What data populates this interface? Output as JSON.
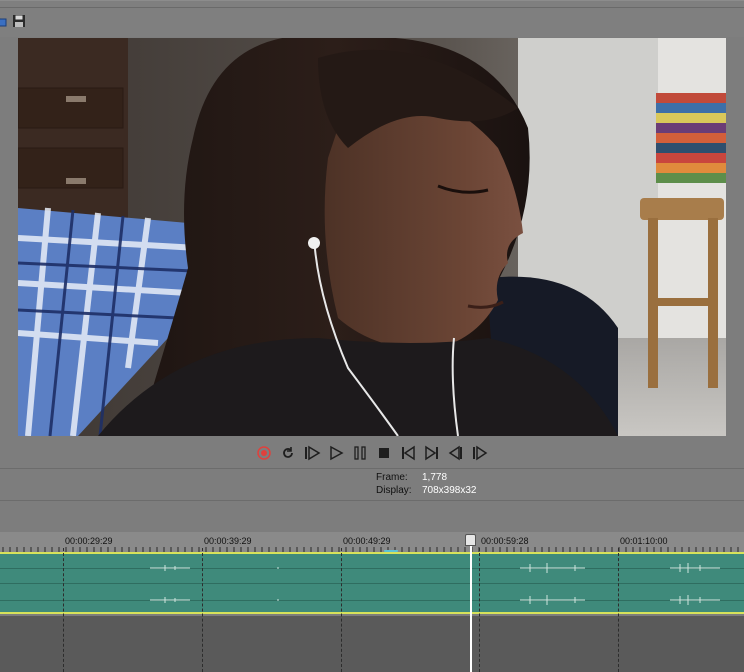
{
  "preview": {
    "frame_label": "Frame:",
    "frame_value": "1,778",
    "display_label": "Display:",
    "display_value": "708x398x32"
  },
  "toolbar": {
    "icons": [
      "folder-icon",
      "save-icon"
    ]
  },
  "transport": {
    "buttons": [
      "record",
      "loop",
      "play-from-start",
      "play",
      "pause",
      "stop",
      "go-to-start",
      "go-to-end",
      "previous-frame",
      "next-frame"
    ]
  },
  "timeline": {
    "ticks": [
      "00:00:29:29",
      "00:00:39:29",
      "00:00:49:29",
      "00:00:59:28",
      "00:01:10:00"
    ]
  },
  "colors": {
    "track": "#3f8a7b",
    "track_edge": "#d7e25a",
    "record": "#e0403c"
  }
}
